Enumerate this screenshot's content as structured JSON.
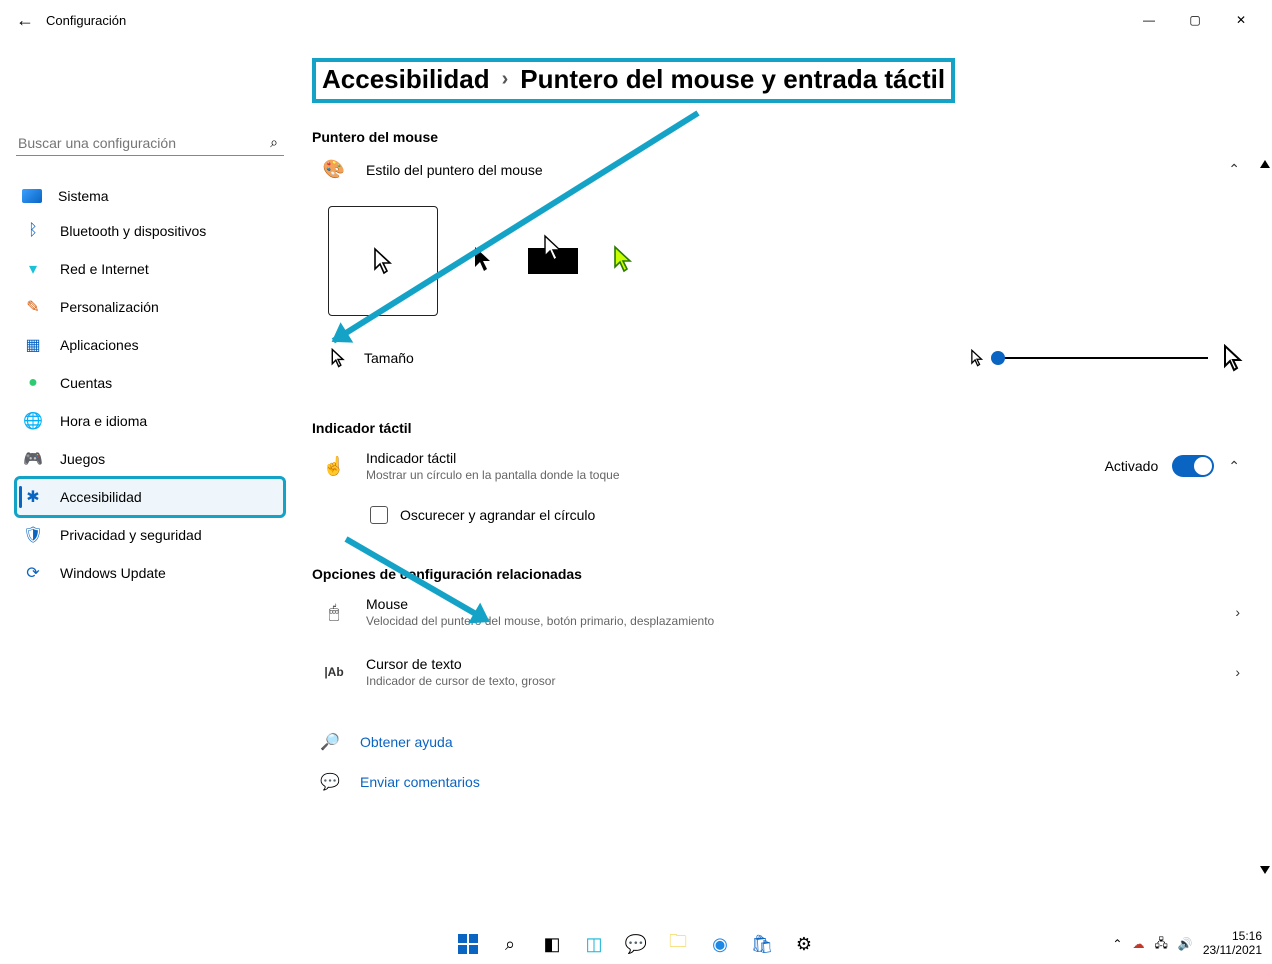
{
  "window": {
    "app_title": "Configuración"
  },
  "search": {
    "placeholder": "Buscar una configuración"
  },
  "sidebar": {
    "items": [
      {
        "label": "Sistema"
      },
      {
        "label": "Bluetooth y dispositivos"
      },
      {
        "label": "Red e Internet"
      },
      {
        "label": "Personalización"
      },
      {
        "label": "Aplicaciones"
      },
      {
        "label": "Cuentas"
      },
      {
        "label": "Hora e idioma"
      },
      {
        "label": "Juegos"
      },
      {
        "label": "Accesibilidad"
      },
      {
        "label": "Privacidad y seguridad"
      },
      {
        "label": "Windows Update"
      }
    ]
  },
  "breadcrumb": {
    "parent": "Accesibilidad",
    "current": "Puntero del mouse y entrada táctil"
  },
  "sections": {
    "pointer_heading": "Puntero del mouse",
    "style_label": "Estilo del puntero del mouse",
    "size_label": "Tamaño",
    "touch_heading": "Indicador táctil",
    "touch_title": "Indicador táctil",
    "touch_sub": "Mostrar un círculo en la pantalla donde la toque",
    "touch_state": "Activado",
    "darken_label": "Oscurecer y agrandar el círculo",
    "related_heading": "Opciones de configuración relacionadas",
    "mouse_title": "Mouse",
    "mouse_sub": "Velocidad del puntero del mouse, botón primario, desplazamiento",
    "textcursor_title": "Cursor de texto",
    "textcursor_sub": "Indicador de cursor de texto, grosor",
    "help_label": "Obtener ayuda",
    "feedback_label": "Enviar comentarios"
  },
  "taskbar": {
    "time": "15:16",
    "date": "23/11/2021"
  },
  "colors": {
    "accent": "#0a64c2",
    "highlight": "#14a3c7"
  }
}
